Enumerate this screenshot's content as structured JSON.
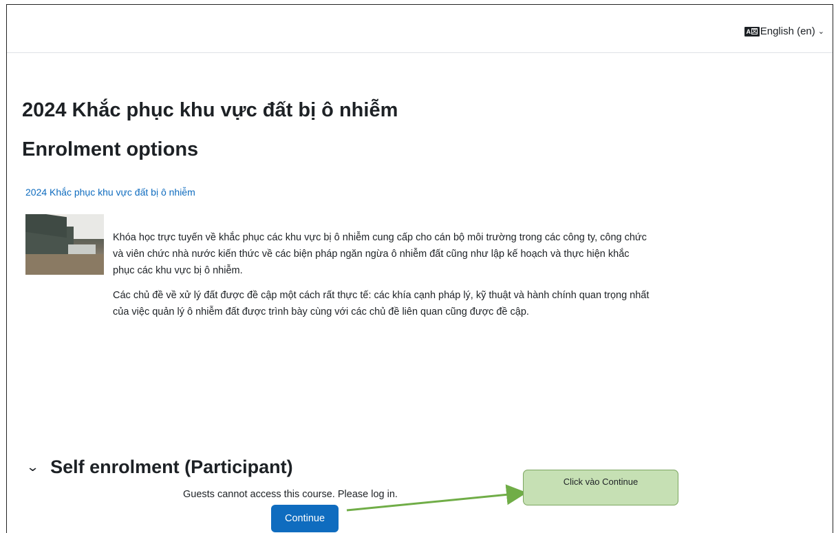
{
  "header": {
    "language_label": "English (en)",
    "language_icon": "language-icon"
  },
  "course": {
    "title": "2024 Khắc phục khu vực đất bị ô nhiễm",
    "link_text": "2024 Khắc phục khu vực đất bị ô nhiễm",
    "summary_p1": "Khóa học trực tuyến về khắc phục các khu vực bị ô nhiễm cung cấp cho cán bộ môi trường trong các công ty, công chức và viên chức nhà nước kiến thức về các biện pháp ngăn ngừa ô nhiễm đất cũng như lập kế hoạch và thực hiện khắc phục các khu vực bị ô nhiễm.",
    "summary_p2": "Các chủ đề về xử lý đất được đề cập một cách rất thực tế: các khía cạnh pháp lý, kỹ thuật và hành chính quan trọng nhất của việc quản lý ô nhiễm đất được trình bày cùng với các chủ đề liên quan cũng được đề cập."
  },
  "page": {
    "heading": "Enrolment options"
  },
  "self_enrolment": {
    "title": "Self enrolment (Participant)",
    "message": "Guests cannot access this course. Please log in.",
    "continue_label": "Continue"
  },
  "annotation": {
    "callout_text": "Click vào Continue",
    "arrow_color": "#70ad47",
    "callout_bg": "#c6e0b4"
  },
  "colors": {
    "link": "#0f6cbf",
    "primary_button": "#0f6cbf",
    "text": "#1d2125"
  }
}
